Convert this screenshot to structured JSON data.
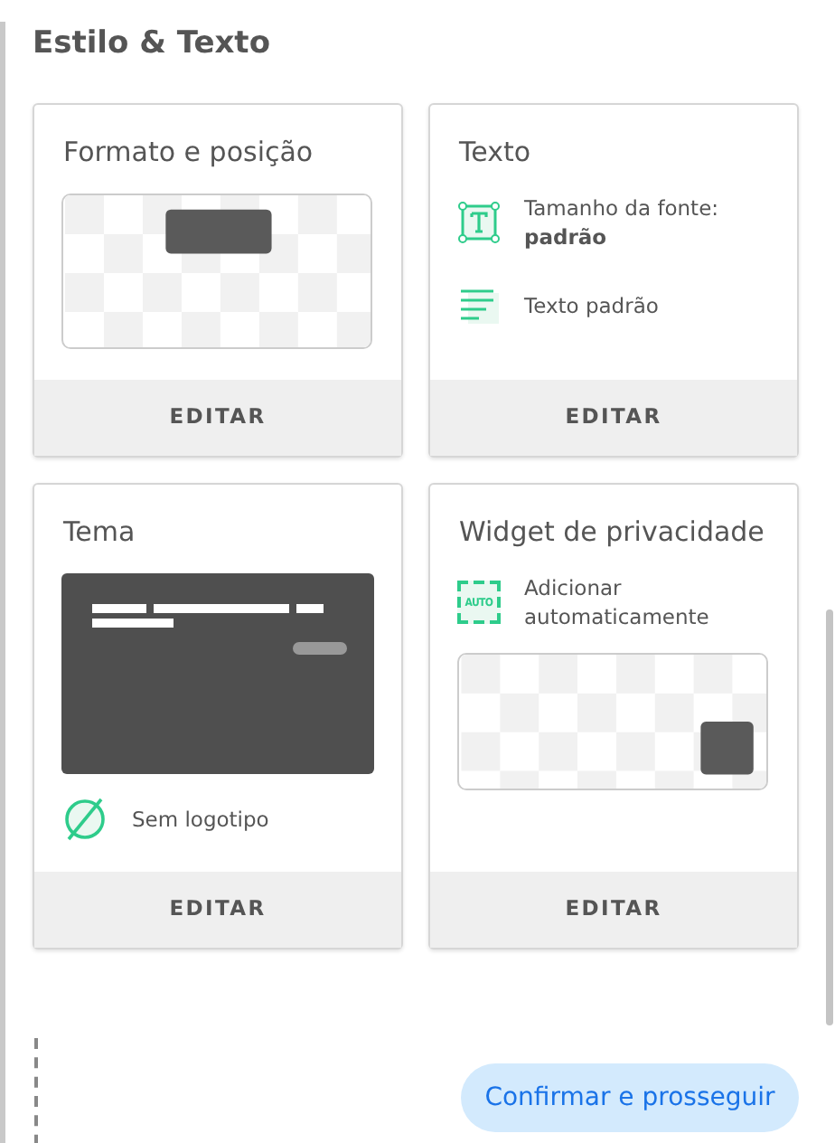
{
  "section_title": "Estilo & Texto",
  "cards": [
    {
      "kind": "format",
      "title": "Formato e posição",
      "action": "EDITAR"
    },
    {
      "kind": "text",
      "title": "Texto",
      "items": [
        {
          "kind": "font-size",
          "text": "Tamanho da fonte: **padrão**"
        },
        {
          "kind": "lines",
          "text": "Texto padrão"
        }
      ],
      "action": "EDITAR"
    },
    {
      "kind": "theme",
      "title": "Tema",
      "items": [
        {
          "kind": "no-logo",
          "text": "Sem logotipo"
        }
      ],
      "action": "EDITAR"
    },
    {
      "kind": "widget",
      "title": "Widget de privacidade",
      "items": [
        {
          "kind": "auto",
          "icon_label": "AUTO",
          "text": "Adicionar automaticamente"
        }
      ],
      "action": "EDITAR"
    }
  ],
  "confirm_button": "Confirmar e prosseguir"
}
